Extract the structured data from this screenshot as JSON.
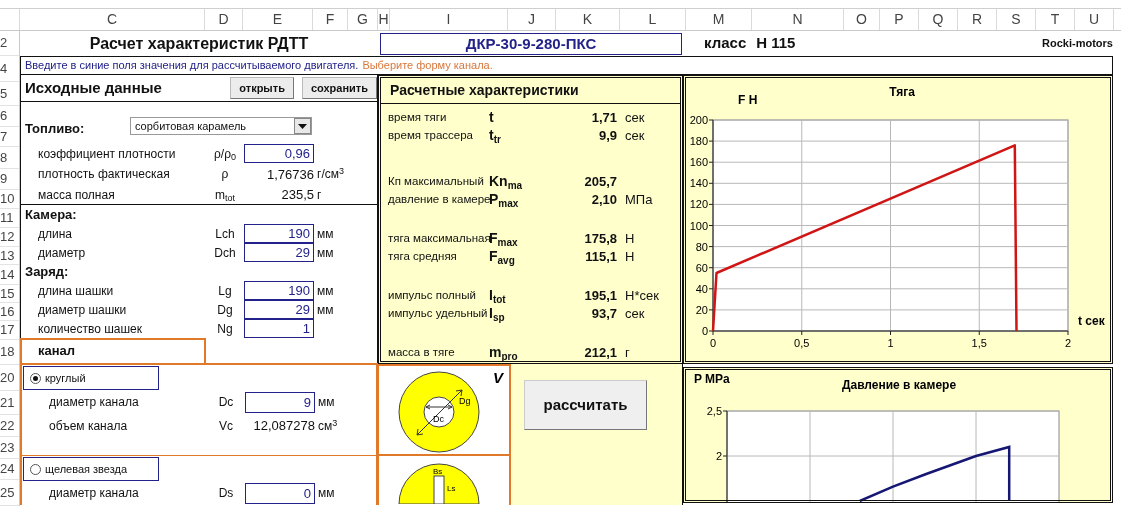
{
  "sheet": {
    "columns": [
      "C",
      "D",
      "E",
      "F",
      "G",
      "H",
      "I",
      "J",
      "K",
      "L",
      "M",
      "N",
      "O",
      "P",
      "Q",
      "R",
      "S",
      "T",
      "U"
    ],
    "rows": [
      "2",
      "4",
      "5",
      "6",
      "7",
      "8",
      "9",
      "10",
      "11",
      "12",
      "13",
      "14",
      "15",
      "16",
      "17",
      "18",
      "20",
      "21",
      "22",
      "23",
      "24",
      "25"
    ]
  },
  "header": {
    "title": "Расчет характеристик РДТТ",
    "motor_code": "ДКР-30-9-280-ПКС",
    "class_label": "класс",
    "class_value": "H 115",
    "brand": "Rocki-motors"
  },
  "instructions": [
    {
      "text": "Введите в синие поля значения для рассчитываемого двигателя.",
      "color": "#22228a"
    },
    {
      "text": "Выберите форму канала.",
      "color": "#d8773a"
    }
  ],
  "input_panel": {
    "title": "Исходные данные",
    "buttons": [
      "открыть",
      "сохранить"
    ],
    "fuel": {
      "label": "Топливо:",
      "value": "сорбитовая карамель"
    },
    "fuel_rows": [
      {
        "kind": "input",
        "label": "коэффициент плотности",
        "symbol": "ρ/ρ$_{0}$",
        "value": "0,96"
      },
      {
        "kind": "readout",
        "label": "плотность фактическая",
        "symbol": "ρ",
        "value": "1,76736",
        "unit": "г/см$^{3}$"
      },
      {
        "kind": "readout",
        "label": "масса полная",
        "symbol": "m$_{tot}$",
        "value": "235,5",
        "unit": "г"
      }
    ],
    "rows": [
      {
        "kind": "section",
        "label": "Камера:"
      },
      {
        "kind": "input",
        "label": "длина",
        "symbol": "Lch",
        "value": "190",
        "unit": "мм"
      },
      {
        "kind": "input",
        "label": "диаметр",
        "symbol": "Dch",
        "value": "29",
        "unit": "мм"
      },
      {
        "kind": "section",
        "label": "Заряд:"
      },
      {
        "kind": "input",
        "label": "длина шашки",
        "symbol": "Lg",
        "value": "190",
        "unit": "мм"
      },
      {
        "kind": "input",
        "label": "диаметр шашки",
        "symbol": "Dg",
        "value": "29",
        "unit": "мм"
      },
      {
        "kind": "input",
        "label": "количество шашек",
        "symbol": "Ng",
        "value": "1"
      }
    ]
  },
  "channel": {
    "title": "канал",
    "options": [
      {
        "label": "круглый",
        "selected": true,
        "rows": [
          {
            "kind": "input",
            "label": "диаметр канала",
            "symbol": "Dc",
            "value": "9",
            "unit": "мм"
          },
          {
            "kind": "readout",
            "label": "объем канала",
            "symbol": "Vc",
            "value": "12,087278",
            "unit": "см$^{3}$"
          }
        ]
      },
      {
        "label": "щелевая звезда",
        "selected": false,
        "rows": [
          {
            "kind": "input",
            "label": "диаметр канала",
            "symbol": "Ds",
            "value": "0",
            "unit": "мм"
          }
        ]
      }
    ]
  },
  "results": {
    "title": "Расчетные характеристики",
    "groups": [
      [
        {
          "label": "время тяги",
          "symbol": "t",
          "value": "1,71",
          "unit": "сек"
        },
        {
          "label": "время трассера",
          "symbol": "t$_{tr}$",
          "value": "9,9",
          "unit": "сек"
        }
      ],
      [
        {
          "label": "Кп максимальный",
          "symbol": "Kn$_{ma}$",
          "value": "205,7"
        },
        {
          "label": "давление в камере",
          "symbol": "P$_{max}$",
          "value": "2,10",
          "unit": "МПа"
        }
      ],
      [
        {
          "label": "тяга максимальная",
          "symbol": "F$_{max}$",
          "value": "175,8",
          "unit": "Н"
        },
        {
          "label": "тяга средняя",
          "symbol": "F$_{avg}$",
          "value": "115,1",
          "unit": "Н"
        }
      ],
      [
        {
          "label": "импульс полный",
          "symbol": "I$_{tot}$",
          "value": "195,1",
          "unit": "Н*сек"
        },
        {
          "label": "импульс удельный",
          "symbol": "I$_{sp}$",
          "value": "93,7",
          "unit": "сек"
        }
      ],
      [
        {
          "label": "масса в тяге",
          "symbol": "m$_{pro}$",
          "value": "212,1",
          "unit": "г"
        }
      ]
    ]
  },
  "diagram_mark": "V",
  "diagrams": [
    {
      "kind": "round",
      "labels": [
        "Dg",
        "Dc"
      ]
    },
    {
      "kind": "slot",
      "labels": [
        "Bs",
        "Ls"
      ]
    }
  ],
  "calculate_button": "рассчитать",
  "charts": [
    {
      "chart_data": {
        "type": "line",
        "title": "Тяга",
        "xlabel": "t сек",
        "ylabel": "F Н",
        "grid": true,
        "xlim": [
          0,
          2
        ],
        "ylim": [
          0,
          200
        ],
        "xticks": [
          0,
          {
            "value": 0.5,
            "label": "0,5"
          },
          1,
          {
            "value": 1.5,
            "label": "1,5"
          },
          2
        ],
        "yticks": [
          0,
          20,
          40,
          60,
          80,
          100,
          120,
          140,
          160,
          180,
          200
        ],
        "x": [
          0,
          0.02,
          1.7,
          1.71
        ],
        "series": [
          {
            "color": "#d01515",
            "values": [
              0,
              55,
              176,
              0
            ]
          }
        ]
      }
    },
    {
      "picture": {
        "title": "Давление в камере",
        "ylabel": "P MPa",
        "scale_labels": [
          "2,5",
          "2"
        ]
      }
    }
  ]
}
